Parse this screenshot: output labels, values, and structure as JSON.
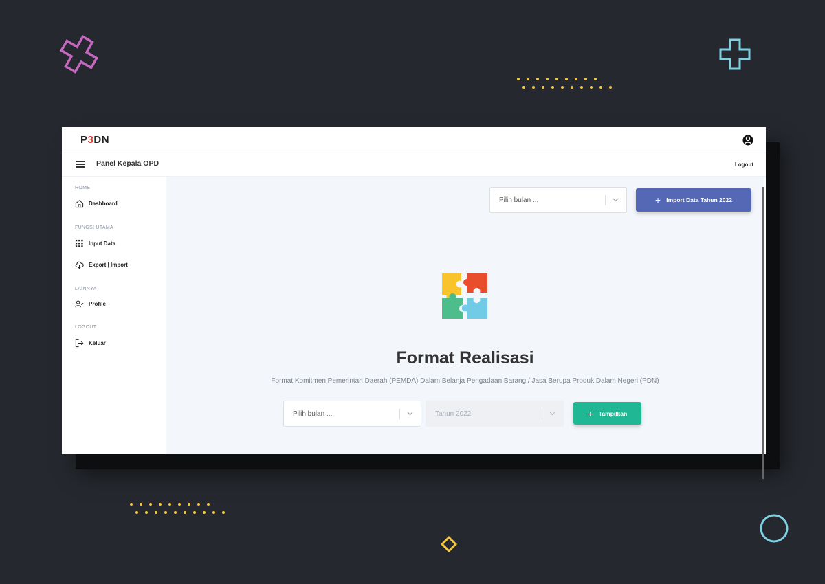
{
  "app": {
    "logo_prefix": "P",
    "logo_accent": "3",
    "logo_suffix": "DN",
    "panel_title": "Panel Kepala OPD",
    "logout_label": "Logout"
  },
  "sidebar": {
    "sections": [
      {
        "label": "HOME",
        "items": [
          {
            "label": "Dashboard",
            "icon": "home-icon"
          }
        ]
      },
      {
        "label": "FUNGSI UTAMA",
        "items": [
          {
            "label": "Input Data",
            "icon": "grid-icon"
          },
          {
            "label": "Export | Import",
            "icon": "cloud-download-icon"
          }
        ]
      },
      {
        "label": "LAINNYA",
        "items": [
          {
            "label": "Profile",
            "icon": "user-check-icon"
          }
        ]
      },
      {
        "label": "LOGOUT",
        "items": [
          {
            "label": "Keluar",
            "icon": "exit-icon"
          }
        ]
      }
    ]
  },
  "toolbar": {
    "month_placeholder": "Pilih bulan ...",
    "import_label": "Import Data Tahun 2022"
  },
  "hero": {
    "title": "Format Realisasi",
    "subtitle": "Format Komitmen Pemerintah Daerah (PEMDA) Dalam Belanja Pengadaan Barang / Jasa Berupa Produk Dalam Negeri (PDN)"
  },
  "filters": {
    "month_placeholder": "Pilih bulan ...",
    "year_value": "Tahun 2022",
    "submit_label": "Tampilkan"
  },
  "colors": {
    "primary": "#5468b6",
    "success": "#20b894",
    "accent_red": "#e53935",
    "background": "#25282e"
  }
}
